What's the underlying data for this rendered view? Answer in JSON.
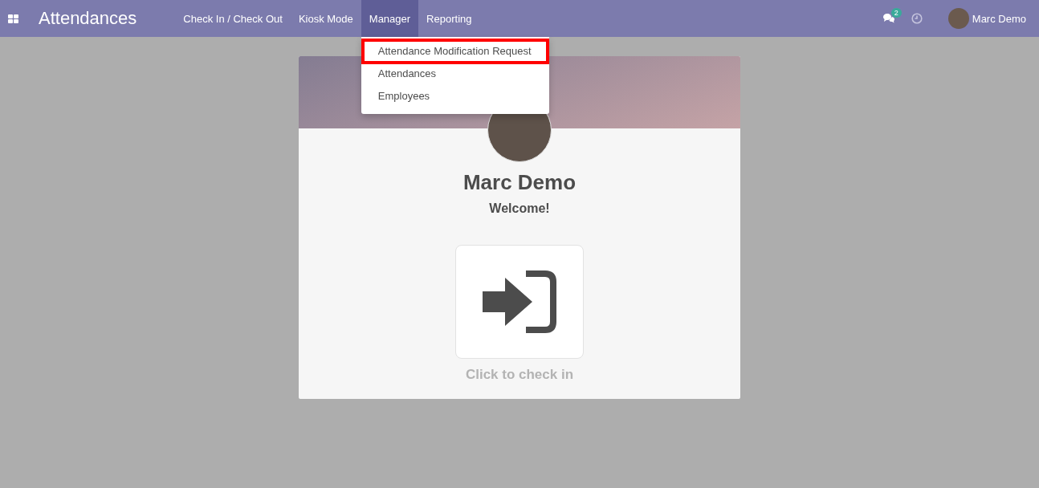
{
  "navbar": {
    "app_title": "Attendances",
    "menu": [
      {
        "label": "Check In / Check Out",
        "selected": false
      },
      {
        "label": "Kiosk Mode",
        "selected": false
      },
      {
        "label": "Manager",
        "selected": true,
        "expanded": true
      },
      {
        "label": "Reporting",
        "selected": false
      }
    ],
    "messages_badge": "2",
    "user_name": "Marc Demo"
  },
  "dropdown": [
    {
      "label": "Attendance Modification Request",
      "highlighted": true
    },
    {
      "label": "Attendances",
      "highlighted": false
    },
    {
      "label": "Employees",
      "highlighted": false
    }
  ],
  "card": {
    "name": "Marc Demo",
    "greeting": "Welcome!",
    "action_label": "Click to check in"
  }
}
